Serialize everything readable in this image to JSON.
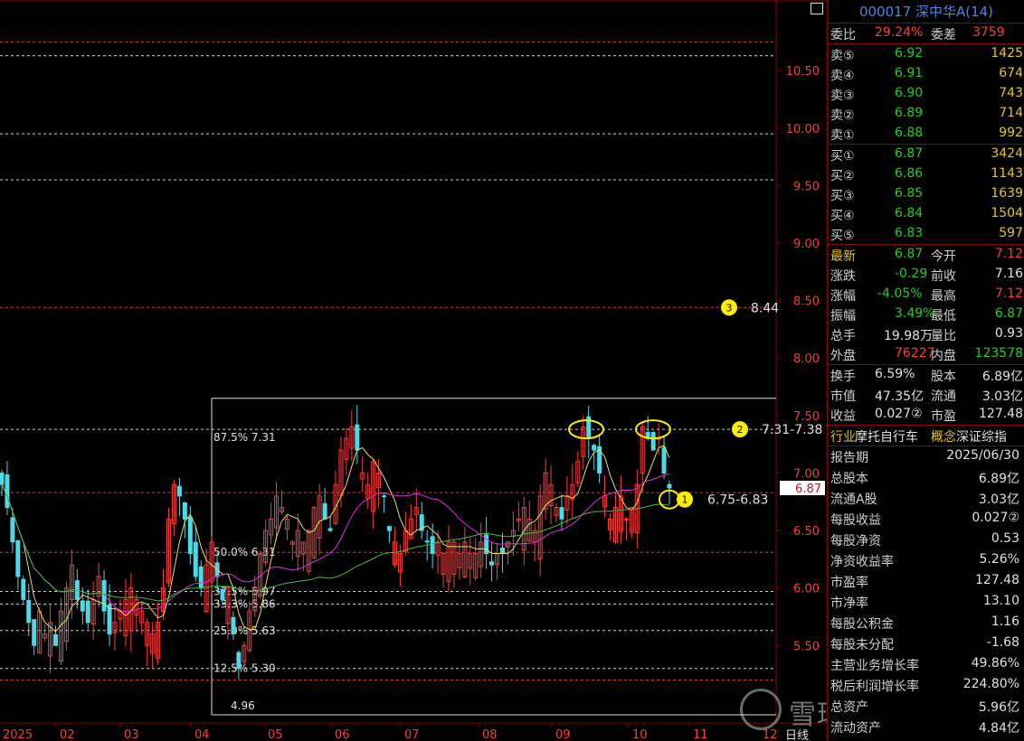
{
  "stock": {
    "title": "000017 深中华A(14)"
  },
  "chart_data": {
    "type": "candlestick",
    "ylim": [
      4.96,
      10.8
    ],
    "y_ticks": [
      "10.50",
      "10.00",
      "9.50",
      "9.00",
      "8.50",
      "8.00",
      "7.50",
      "7.00",
      "6.50",
      "6.00",
      "5.50"
    ],
    "x_ticks": [
      "2025",
      "02",
      "03",
      "04",
      "05",
      "06",
      "07",
      "08",
      "09",
      "10",
      "11",
      "12"
    ],
    "period_label": "日线",
    "current_price": "6.87",
    "fib_levels": [
      {
        "label": "87.5% 7.31",
        "value": 7.31
      },
      {
        "label": "50.0% 6.31",
        "value": 6.31
      },
      {
        "label": "37.5% 5.97",
        "value": 5.97
      },
      {
        "label": "33.3% 5.86",
        "value": 5.86
      },
      {
        "label": "25.0% 5.63",
        "value": 5.63
      },
      {
        "label": "12.5% 5.30",
        "value": 5.3
      },
      {
        "label": "4.96",
        "value": 4.96
      }
    ],
    "extra_dashed_levels": [
      10.63,
      9.95,
      9.55,
      8.44,
      7.38,
      6.83
    ],
    "top_level": 7.65,
    "annotations": [
      {
        "num": "1",
        "text": "6.75-6.83"
      },
      {
        "num": "2",
        "text": "7.31-7.38"
      },
      {
        "num": "3",
        "text": "8.44"
      }
    ],
    "close_series": [
      6.9,
      6.7,
      6.4,
      6.1,
      5.9,
      5.7,
      5.5,
      5.8,
      5.6,
      5.7,
      5.5,
      5.8,
      6.0,
      6.2,
      5.9,
      5.8,
      5.7,
      5.9,
      6.1,
      5.8,
      5.6,
      5.7,
      5.8,
      5.9,
      6.0,
      5.9,
      5.8,
      5.7,
      5.6,
      5.7,
      6.0,
      6.6,
      6.9,
      6.8,
      6.6,
      6.3,
      6.1,
      6.0,
      6.2,
      6.4,
      6.1,
      5.9,
      6.0,
      5.6,
      5.3,
      5.5,
      5.8,
      6.0,
      6.3,
      6.5,
      6.6,
      6.8,
      6.7,
      6.6,
      6.4,
      6.5,
      6.4,
      6.5,
      6.7,
      6.8,
      6.6,
      6.5,
      6.9,
      7.2,
      7.3,
      7.4,
      7.2,
      7.0,
      6.9,
      7.1,
      7.0,
      6.8,
      6.5,
      6.4,
      6.3,
      6.5,
      6.6,
      6.7,
      6.5,
      6.4,
      6.3,
      6.4,
      6.3,
      6.4,
      6.4,
      6.3,
      6.4,
      6.3,
      6.3,
      6.4,
      6.3,
      6.2,
      6.3,
      6.3,
      6.4,
      6.5,
      6.6,
      6.7,
      6.6,
      6.5,
      6.8,
      7.0,
      6.9,
      6.7,
      6.6,
      6.8,
      6.9,
      7.1,
      7.4,
      7.3,
      7.2,
      7.0,
      6.8,
      6.6,
      6.7,
      6.8,
      6.6,
      6.7,
      6.9,
      7.4,
      7.3,
      7.2,
      7.3,
      7.0,
      6.87
    ],
    "series": [
      {
        "name": "ma_yellow",
        "color": "#e8e060"
      },
      {
        "name": "ma_magenta",
        "color": "#e030e0"
      },
      {
        "name": "ma_green",
        "color": "#40c040"
      }
    ]
  },
  "panel": {
    "ratio": {
      "label": "委比",
      "value": "29.24%",
      "label2": "委差",
      "value2": "3759"
    },
    "sells": [
      {
        "label": "卖⑤",
        "price": "6.92",
        "vol": "1425"
      },
      {
        "label": "卖④",
        "price": "6.91",
        "vol": "674"
      },
      {
        "label": "卖③",
        "price": "6.90",
        "vol": "743"
      },
      {
        "label": "卖②",
        "price": "6.89",
        "vol": "714"
      },
      {
        "label": "卖①",
        "price": "6.88",
        "vol": "992"
      }
    ],
    "buys": [
      {
        "label": "买①",
        "price": "6.87",
        "vol": "3424"
      },
      {
        "label": "买②",
        "price": "6.86",
        "vol": "1143"
      },
      {
        "label": "买③",
        "price": "6.85",
        "vol": "1639"
      },
      {
        "label": "买④",
        "price": "6.84",
        "vol": "1504"
      },
      {
        "label": "买⑤",
        "price": "6.83",
        "vol": "597"
      }
    ],
    "quote": [
      {
        "l1": "最新",
        "v1": "6.87",
        "l2": "今开",
        "v2": "7.12"
      },
      {
        "l1": "涨跌",
        "v1": "-0.29",
        "l2": "前收",
        "v2": "7.16"
      },
      {
        "l1": "涨幅",
        "v1": "-4.05%",
        "l2": "最高",
        "v2": "7.12"
      },
      {
        "l1": "振幅",
        "v1": "3.49%",
        "l2": "最低",
        "v2": "6.87"
      },
      {
        "l1": "总手",
        "v1": "19.98万",
        "l2": "量比",
        "v2": "0.93"
      },
      {
        "l1": "外盘",
        "v1": "76227",
        "l2": "内盘",
        "v2": "123578"
      }
    ],
    "stats": [
      {
        "l1": "换手",
        "v1": "6.59%",
        "l2": "股本",
        "v2": "6.89亿"
      },
      {
        "l1": "市值",
        "v1": "47.35亿",
        "l2": "流通",
        "v2": "3.03亿"
      },
      {
        "l1": "收益",
        "v1": "0.027②",
        "l2": "市盈",
        "v2": "127.48"
      }
    ],
    "industry": {
      "label": "行业",
      "value": "摩托自行车",
      "label2": "概念",
      "value2": "深证综指"
    },
    "finance": [
      {
        "l": "报告期",
        "v": "2025/06/30"
      },
      {
        "l": "总股本",
        "v": "6.89亿"
      },
      {
        "l": "流通A股",
        "v": "3.03亿"
      },
      {
        "l": "每股收益",
        "v": "0.027②"
      },
      {
        "l": "每股净资",
        "v": "0.53"
      },
      {
        "l": "净资收益率",
        "v": "5.26%"
      },
      {
        "l": "市盈率",
        "v": "127.48"
      },
      {
        "l": "市净率",
        "v": "13.10"
      },
      {
        "l": "每股公积金",
        "v": "1.16"
      },
      {
        "l": "每股未分配",
        "v": "-1.68"
      },
      {
        "l": "主营业务增长率",
        "v": "49.86%"
      },
      {
        "l": "税后利润增长率",
        "v": "224.80%"
      },
      {
        "l": "总资产",
        "v": "5.96亿"
      },
      {
        "l": "流动资产",
        "v": "4.84亿"
      }
    ]
  },
  "watermark": "雪球：逮逮有为",
  "colors": {
    "up": "#ff3b3b",
    "down": "#4dd9e8",
    "grid_red": "#8b0000",
    "annot_yellow": "#ffee00"
  }
}
